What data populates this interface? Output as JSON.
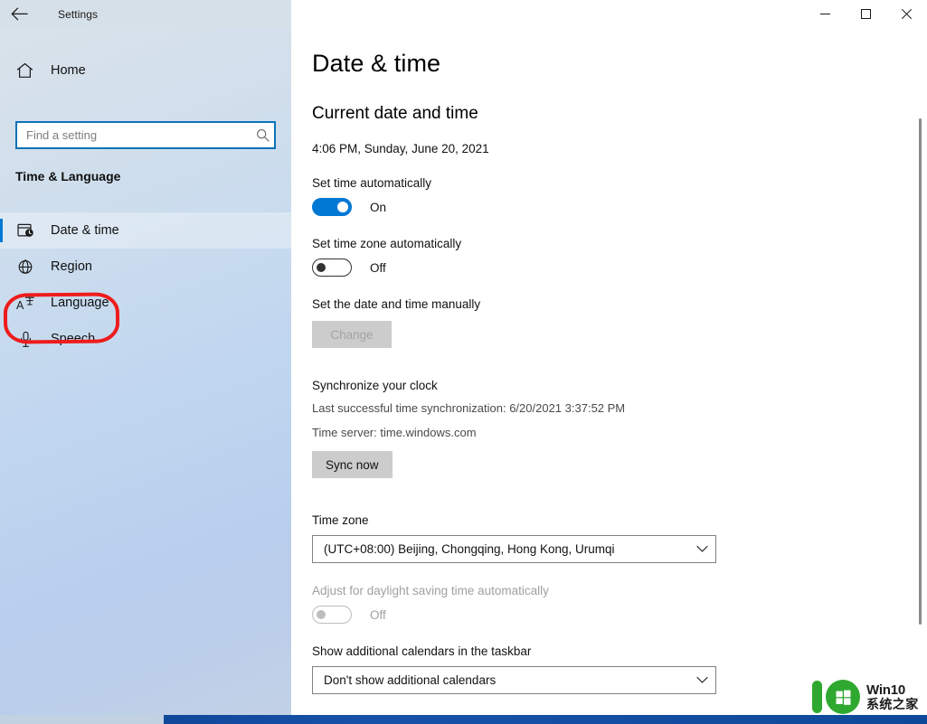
{
  "window": {
    "title": "Settings",
    "back_icon": "back-arrow-icon",
    "minimize_label": "Minimize",
    "maximize_label": "Maximize",
    "close_label": "Close"
  },
  "sidebar": {
    "home_label": "Home",
    "home_icon": "home-icon",
    "search": {
      "placeholder": "Find a setting",
      "value": "",
      "icon": "search-icon"
    },
    "group_title": "Time & Language",
    "items": [
      {
        "label": "Date & time",
        "icon": "calendar-clock-icon",
        "active": true
      },
      {
        "label": "Region",
        "icon": "globe-icon",
        "active": false
      },
      {
        "label": "Language",
        "icon": "language-character-icon",
        "active": false
      },
      {
        "label": "Speech",
        "icon": "microphone-icon",
        "active": false
      }
    ],
    "annotation": {
      "target": "Language",
      "shape": "rounded-rectangle",
      "color": "#ee1c1c"
    }
  },
  "main": {
    "page_title": "Date & time",
    "current_section": {
      "heading": "Current date and time",
      "value": "4:06 PM, Sunday, June 20, 2021"
    },
    "set_time_automatically": {
      "label": "Set time automatically",
      "state": "On",
      "on": true,
      "disabled": false
    },
    "set_timezone_automatically": {
      "label": "Set time zone automatically",
      "state": "Off",
      "on": false,
      "disabled": false
    },
    "set_manually": {
      "label": "Set the date and time manually",
      "button_label": "Change",
      "button_disabled": true
    },
    "synchronize": {
      "heading": "Synchronize your clock",
      "last_sync": "Last successful time synchronization: 6/20/2021 3:37:52 PM",
      "time_server": "Time server: time.windows.com",
      "button_label": "Sync now"
    },
    "time_zone": {
      "label": "Time zone",
      "value": "(UTC+08:00) Beijing, Chongqing, Hong Kong, Urumqi",
      "arrow_icon": "chevron-down-icon"
    },
    "daylight_saving": {
      "label": "Adjust for daylight saving time automatically",
      "state": "Off",
      "on": false,
      "disabled": true
    },
    "additional_calendars": {
      "label": "Show additional calendars in the taskbar",
      "value": "Don't show additional calendars",
      "arrow_icon": "chevron-down-icon"
    }
  },
  "watermark": {
    "line1": "Win10",
    "line2": "系统之家",
    "color": "#2fa82f"
  },
  "colors": {
    "accent": "#0078d4",
    "annotation": "#ee1c1c",
    "sidebar_tint": "#c2d7ef",
    "watermark_green": "#2fa82f"
  }
}
